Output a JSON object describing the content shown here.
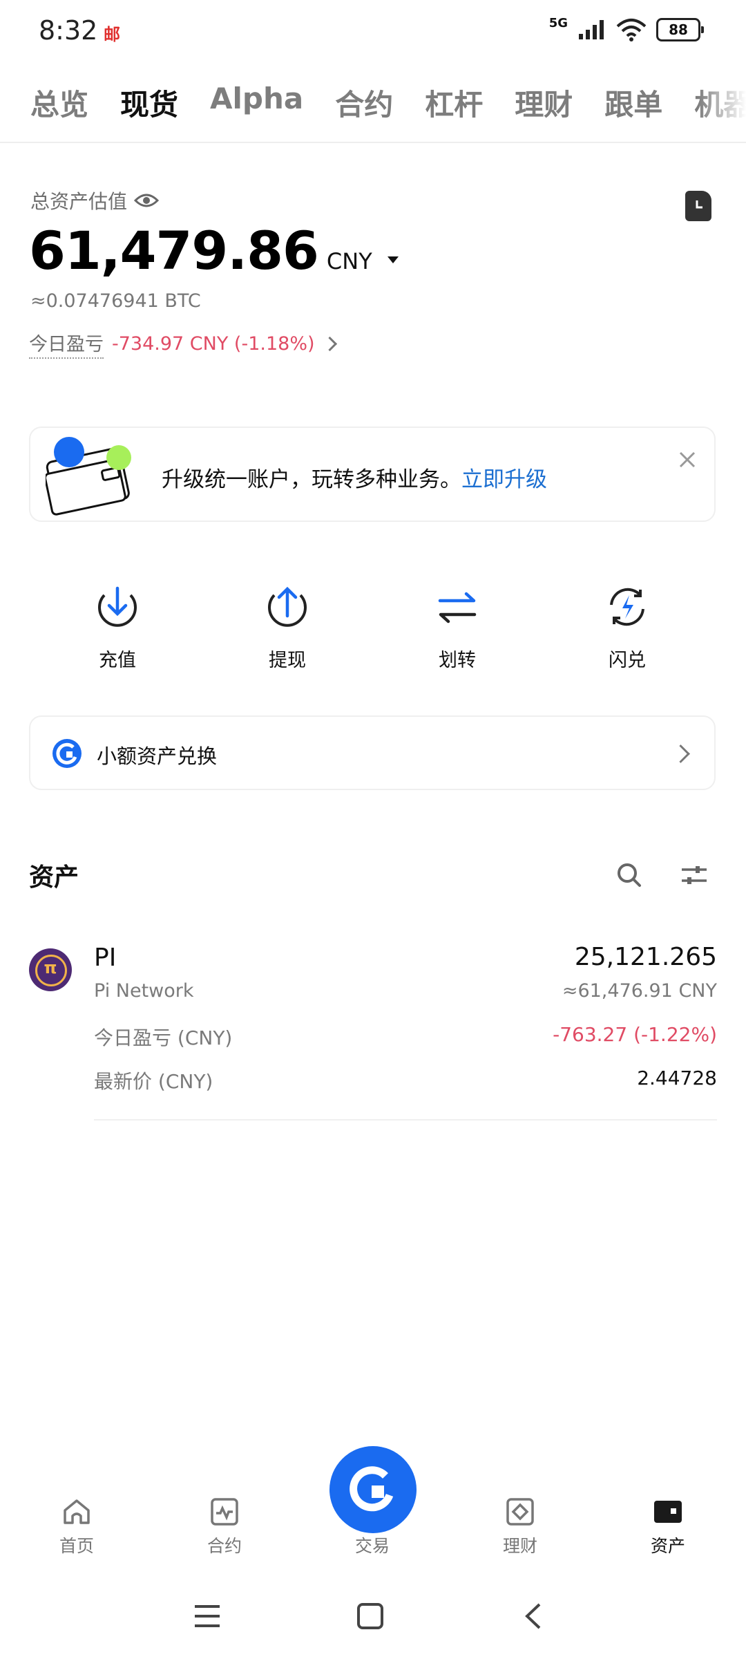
{
  "status_bar": {
    "time": "8:32",
    "app_icon_text": "邮",
    "network": "5G",
    "battery": "88"
  },
  "tabs": [
    {
      "label": "总览",
      "active": false
    },
    {
      "label": "现货",
      "active": true
    },
    {
      "label": "Alpha",
      "active": false
    },
    {
      "label": "合约",
      "active": false
    },
    {
      "label": "杠杆",
      "active": false
    },
    {
      "label": "理财",
      "active": false
    },
    {
      "label": "跟单",
      "active": false
    },
    {
      "label": "机器",
      "active": false
    }
  ],
  "overview": {
    "label": "总资产估值",
    "value": "61,479.86",
    "currency": "CNY",
    "btc": "≈0.07476941 BTC",
    "pnl_label": "今日盈亏",
    "pnl_value": "-734.97 CNY (-1.18%)"
  },
  "banner": {
    "text": "升级统一账户，玩转多种业务。",
    "link": "立即升级"
  },
  "actions": [
    {
      "label": "充值",
      "icon": "deposit-icon"
    },
    {
      "label": "提现",
      "icon": "withdraw-icon"
    },
    {
      "label": "划转",
      "icon": "transfer-icon"
    },
    {
      "label": "闪兑",
      "icon": "convert-icon"
    }
  ],
  "small_asset": {
    "label": "小额资产兑换"
  },
  "assets": {
    "title": "资产",
    "items": [
      {
        "symbol": "PI",
        "name": "Pi Network",
        "amount": "25,121.265",
        "value": "≈61,476.91 CNY",
        "pnl_label": "今日盈亏 (CNY)",
        "pnl_value": "-763.27 (-1.22%)",
        "price_label": "最新价 (CNY)",
        "price_value": "2.44728"
      }
    ]
  },
  "bottom_nav": [
    {
      "label": "首页",
      "icon": "home-icon",
      "active": false
    },
    {
      "label": "合约",
      "icon": "futures-icon",
      "active": false
    },
    {
      "label": "交易",
      "icon": "trade-icon",
      "active": false
    },
    {
      "label": "理财",
      "icon": "earn-icon",
      "active": false
    },
    {
      "label": "资产",
      "icon": "wallet-icon",
      "active": true
    }
  ],
  "colors": {
    "accent": "#1a6bf0",
    "negative": "#e04b64",
    "link": "#1c6fd1"
  }
}
